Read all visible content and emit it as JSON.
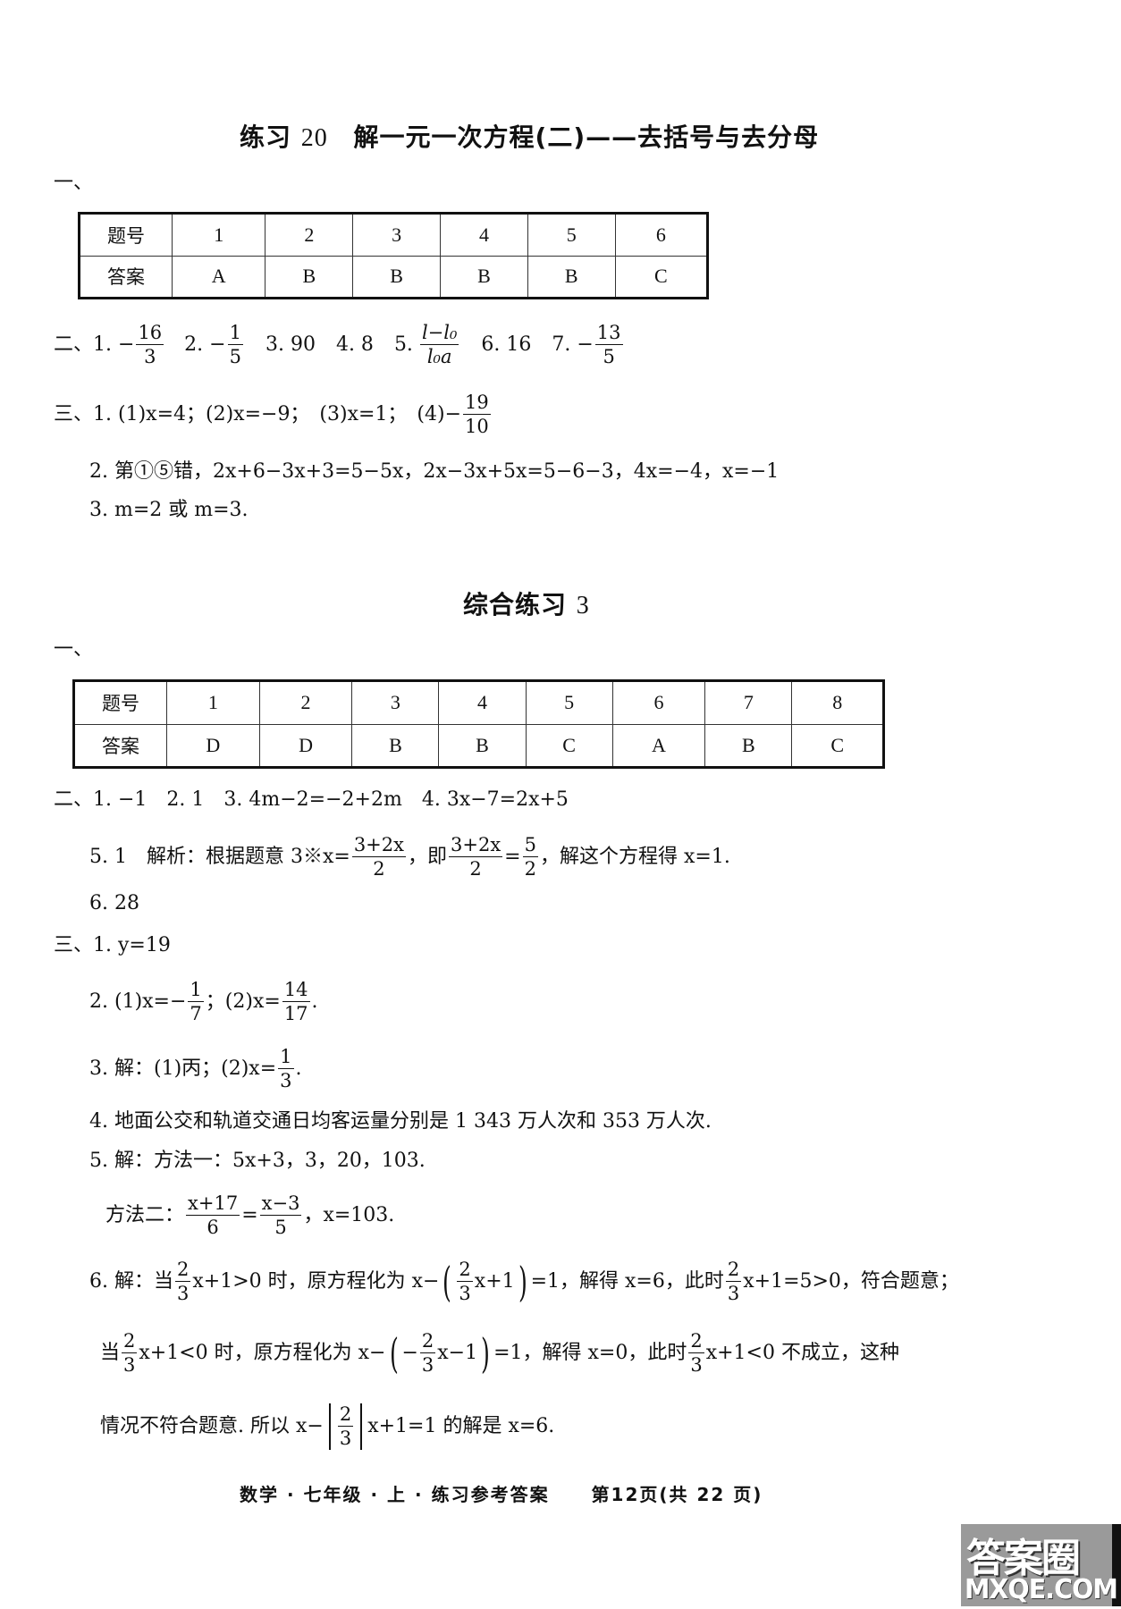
{
  "section1": {
    "title_prefix": "练习",
    "title_num": "20",
    "title_main": "解一元一次方程(二)——去括号与去分母",
    "part1_label": "一、",
    "table": {
      "header_label": "题号",
      "answer_label": "答案",
      "numbers": [
        "1",
        "2",
        "3",
        "4",
        "5",
        "6"
      ],
      "answers": [
        "A",
        "B",
        "B",
        "B",
        "B",
        "C"
      ]
    },
    "part2": {
      "label": "二、",
      "q1_prefix": "1. −",
      "q1_num": "16",
      "q1_den": "3",
      "q2_prefix": "2. −",
      "q2_num": "1",
      "q2_den": "5",
      "q3": "3. 90",
      "q4": "4. 8",
      "q5_prefix": "5.",
      "q5_num": "l−l₀",
      "q5_den": "l₀a",
      "q6": "6. 16",
      "q7_prefix": "7. −",
      "q7_num": "13",
      "q7_den": "5"
    },
    "part3": {
      "label": "三、",
      "q1_text": "1. (1)x=4；(2)x=−9；　(3)x=1；　(4)−",
      "q1_num": "19",
      "q1_den": "10",
      "q2_text": "2. 第①⑤错，2x+6−3x+3=5−5x，2x−3x+5x=5−6−3，4x=−4，x=−1",
      "q3_text": "3. m=2 或 m=3."
    }
  },
  "section2": {
    "title_main": "综合练习",
    "title_num": "3",
    "part1_label": "一、",
    "table": {
      "header_label": "题号",
      "answer_label": "答案",
      "numbers": [
        "1",
        "2",
        "3",
        "4",
        "5",
        "6",
        "7",
        "8"
      ],
      "answers": [
        "D",
        "D",
        "B",
        "B",
        "C",
        "A",
        "B",
        "C"
      ]
    },
    "part2": {
      "label": "二、",
      "line1": "1. −1　2. 1　3. 4m−2=−2+2m　4. 3x−7=2x+5",
      "q5_a": "5. 1　解析：根据题意 3※x=",
      "q5_f1_num": "3+2x",
      "q5_f1_den": "2",
      "q5_b": "，即",
      "q5_f2_num": "3+2x",
      "q5_f2_den": "2",
      "q5_c": "=",
      "q5_f3_num": "5",
      "q5_f3_den": "2",
      "q5_d": "，解这个方程得 x=1.",
      "q6": "6. 28"
    },
    "part3": {
      "label": "三、",
      "q1": "1. y=19",
      "q2_a": "2. (1)x=−",
      "q2_f1_num": "1",
      "q2_f1_den": "7",
      "q2_b": "；(2)x=",
      "q2_f2_num": "14",
      "q2_f2_den": "17",
      "q2_c": ".",
      "q3_a": "3. 解：(1)丙；(2)x=",
      "q3_f_num": "1",
      "q3_f_den": "3",
      "q3_b": ".",
      "q4": "4. 地面公交和轨道交通日均客运量分别是 1 343 万人次和 353 万人次.",
      "q5_line1": "5. 解：方法一：5x+3，3，20，103.",
      "q5_line2_a": "方法二：",
      "q5_f1_num": "x+17",
      "q5_f1_den": "6",
      "q5_line2_b": "=",
      "q5_f2_num": "x−3",
      "q5_f2_den": "5",
      "q5_line2_c": "，x=103.",
      "q6_l1_a": "6. 解：当",
      "q6_l1_b": "x+1>0 时，原方程化为 x−",
      "q6_l1_c": "x+1",
      "q6_l1_d": "=1，解得 x=6，此时",
      "q6_l1_e": "x+1=5>0，符合题意；",
      "q6_l2_a": "当",
      "q6_l2_b": "x+1<0 时，原方程化为 x−",
      "q6_l2_c": "−",
      "q6_l2_d": "x−1",
      "q6_l2_e": "=1，解得 x=0，此时",
      "q6_l2_f": "x+1<0 不成立，这种",
      "q6_l3_a": "情况不符合题意. 所以 x−",
      "q6_l3_b": "x+1=1 的解是 x=6.",
      "frac_num": "2",
      "frac_den": "3"
    }
  },
  "footer": {
    "book": "数学 · 七年级 · 上 · 练习参考答案",
    "page": "第12页(共 22 页)"
  },
  "watermark": {
    "cn": "答案圈",
    "en": "MXQE.COM"
  }
}
